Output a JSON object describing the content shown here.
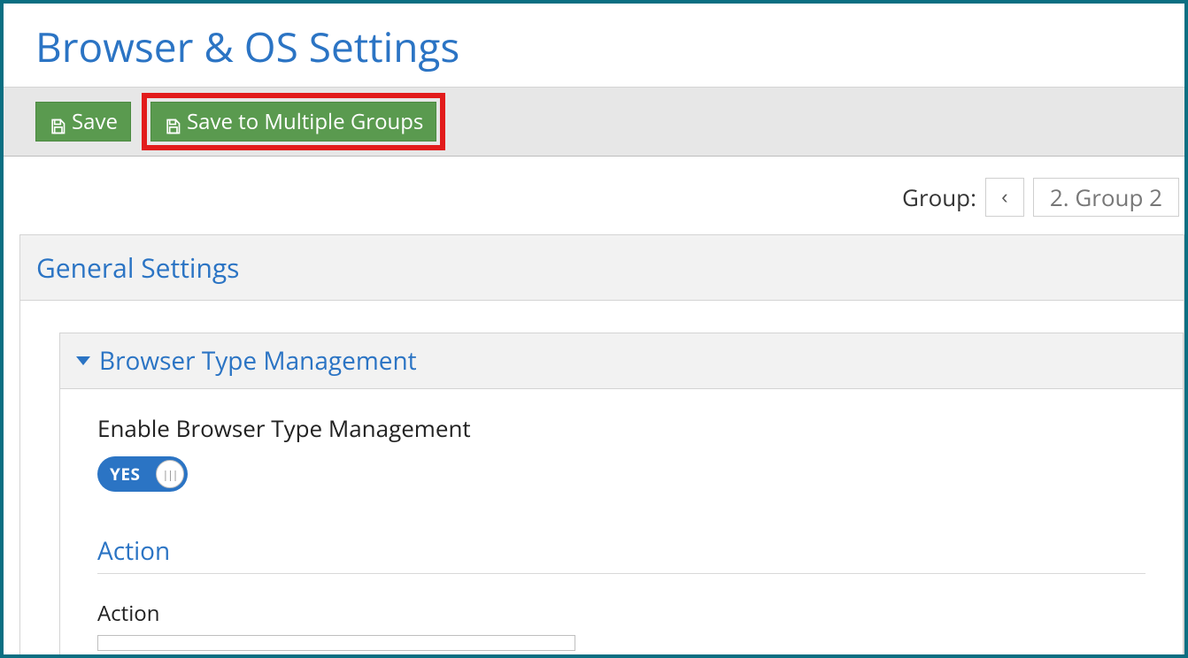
{
  "page_title": "Browser & OS Settings",
  "toolbar": {
    "save_label": "Save",
    "save_multi_label": "Save to Multiple Groups"
  },
  "group_selector": {
    "label": "Group:",
    "prev_glyph": "‹",
    "current": "2. Group 2"
  },
  "general_settings_title": "General Settings",
  "browser_type_mgmt": {
    "title": "Browser Type Management",
    "enable_label": "Enable Browser Type Management",
    "toggle_state": "YES",
    "toggle_grip": "|||"
  },
  "action_section": {
    "heading": "Action",
    "label": "Action"
  }
}
